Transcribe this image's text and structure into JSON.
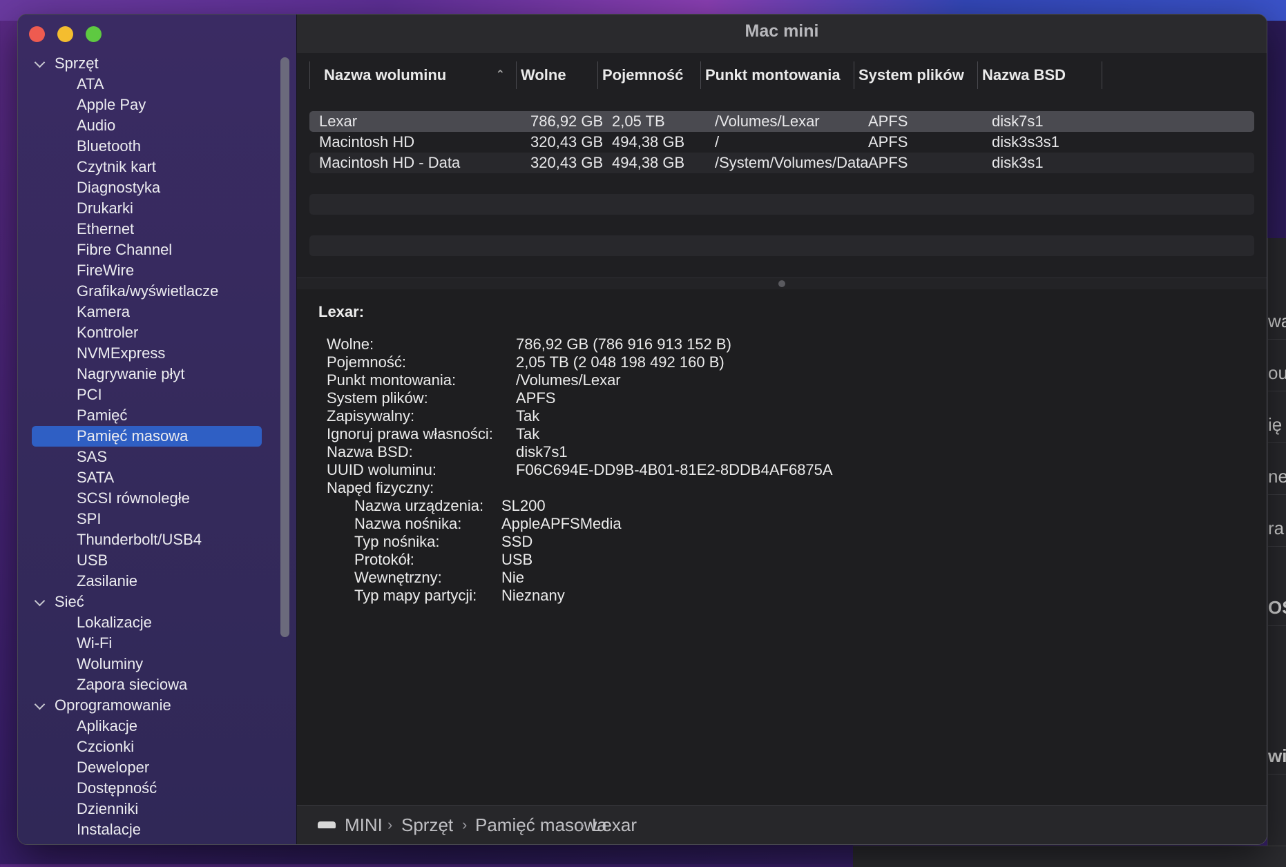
{
  "window": {
    "title": "Mac mini"
  },
  "sidebar": {
    "sections": [
      {
        "label": "Sprzęt",
        "items": [
          "ATA",
          "Apple Pay",
          "Audio",
          "Bluetooth",
          "Czytnik kart",
          "Diagnostyka",
          "Drukarki",
          "Ethernet",
          "Fibre Channel",
          "FireWire",
          "Grafika/wyświetlacze",
          "Kamera",
          "Kontroler",
          "NVMExpress",
          "Nagrywanie płyt",
          "PCI",
          "Pamięć",
          "Pamięć masowa",
          "SAS",
          "SATA",
          "SCSI równoległe",
          "SPI",
          "Thunderbolt/USB4",
          "USB",
          "Zasilanie"
        ]
      },
      {
        "label": "Sieć",
        "items": [
          "Lokalizacje",
          "Wi-Fi",
          "Woluminy",
          "Zapora sieciowa"
        ]
      },
      {
        "label": "Oprogramowanie",
        "items": [
          "Aplikacje",
          "Czcionki",
          "Deweloper",
          "Dostępność",
          "Dzienniki",
          "Instalacje"
        ]
      }
    ],
    "selected": "Pamięć masowa"
  },
  "table": {
    "columns": [
      "Nazwa woluminu",
      "Wolne",
      "Pojemność",
      "Punkt montowania",
      "System plików",
      "Nazwa BSD"
    ],
    "rows": [
      [
        "Lexar",
        "786,92 GB",
        "2,05 TB",
        "/Volumes/Lexar",
        "APFS",
        "disk7s1"
      ],
      [
        "Macintosh HD",
        "320,43 GB",
        "494,38 GB",
        "/",
        "APFS",
        "disk3s3s1"
      ],
      [
        "Macintosh HD - Data",
        "320,43 GB",
        "494,38 GB",
        "/System/Volumes/Data",
        "APFS",
        "disk3s1"
      ]
    ]
  },
  "detail": {
    "title": "Lexar:",
    "fields": [
      {
        "label": "Wolne:",
        "value": "786,92 GB (786 916 913 152 B)"
      },
      {
        "label": "Pojemność:",
        "value": "2,05 TB (2 048 198 492 160 B)"
      },
      {
        "label": "Punkt montowania:",
        "value": "/Volumes/Lexar"
      },
      {
        "label": "System plików:",
        "value": "APFS"
      },
      {
        "label": "Zapisywalny:",
        "value": "Tak"
      },
      {
        "label": "Ignoruj prawa własności:",
        "value": "Tak"
      },
      {
        "label": "Nazwa BSD:",
        "value": "disk7s1"
      },
      {
        "label": "UUID woluminu:",
        "value": "F06C694E-DD9B-4B01-81E2-8DDB4AF6875A"
      },
      {
        "label": "Napęd fizyczny:",
        "value": ""
      }
    ],
    "physical": [
      {
        "label": "Nazwa urządzenia:",
        "value": "SL200"
      },
      {
        "label": "Nazwa nośnika:",
        "value": "AppleAPFSMedia"
      },
      {
        "label": "Typ nośnika:",
        "value": "SSD"
      },
      {
        "label": "Protokół:",
        "value": "USB"
      },
      {
        "label": "Wewnętrzny:",
        "value": "Nie"
      },
      {
        "label": "Typ mapy partycji:",
        "value": "Nieznany"
      }
    ]
  },
  "pathbar": {
    "crumbs": [
      "MINI",
      "Sprzęt",
      "Pamięć masowa",
      "Lexar"
    ],
    "separator": "›"
  },
  "background_fragments": [
    "wa",
    "ou",
    "ię",
    "ne",
    "ra",
    "OS",
    "wi"
  ]
}
